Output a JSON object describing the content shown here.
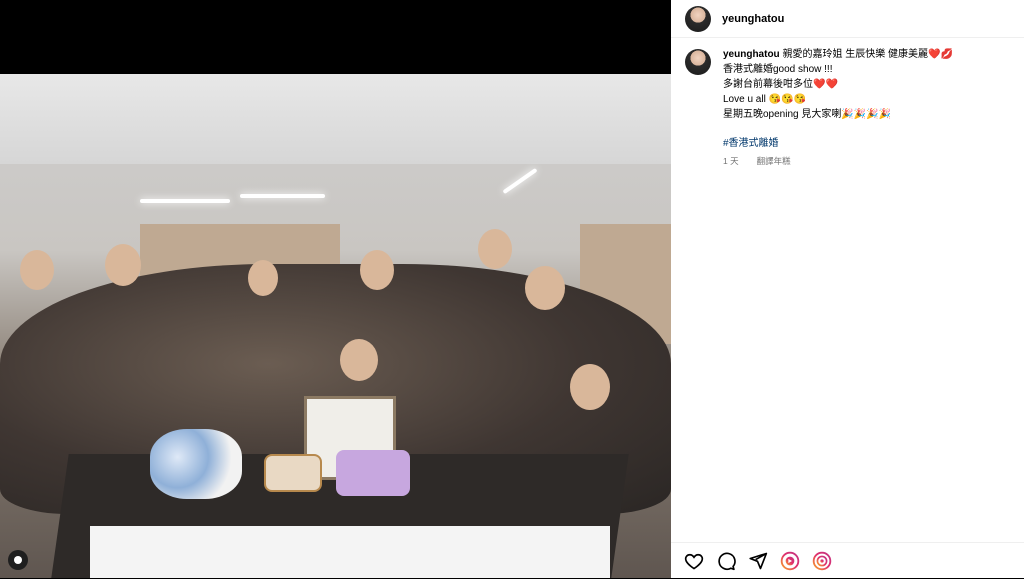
{
  "post": {
    "username": "yeunghatou",
    "caption_lines": [
      "親愛的嘉玲姐 生辰快樂 健康美麗❤️💋",
      "香港式離婚good show !!!",
      "多謝台前幕後咁多位❤️❤️",
      "Love u all 😘😘😘",
      "星期五晚opening 見大家喇🎉🎉🎉🎉"
    ],
    "hashtag": "#香港式離婚",
    "time_ago": "1 天",
    "translate_label": "翻譯年糕"
  },
  "icons": {
    "like": "heart-icon",
    "comment": "comment-icon",
    "share": "send-icon",
    "app1": "instagram-app-icon",
    "app2": "instagram-story-icon",
    "user_tag": "user-tag-icon"
  },
  "colors": {
    "hashtag": "#00376b",
    "meta": "#737373",
    "divider": "#efefef",
    "gradient_icon": "#e1306c"
  }
}
